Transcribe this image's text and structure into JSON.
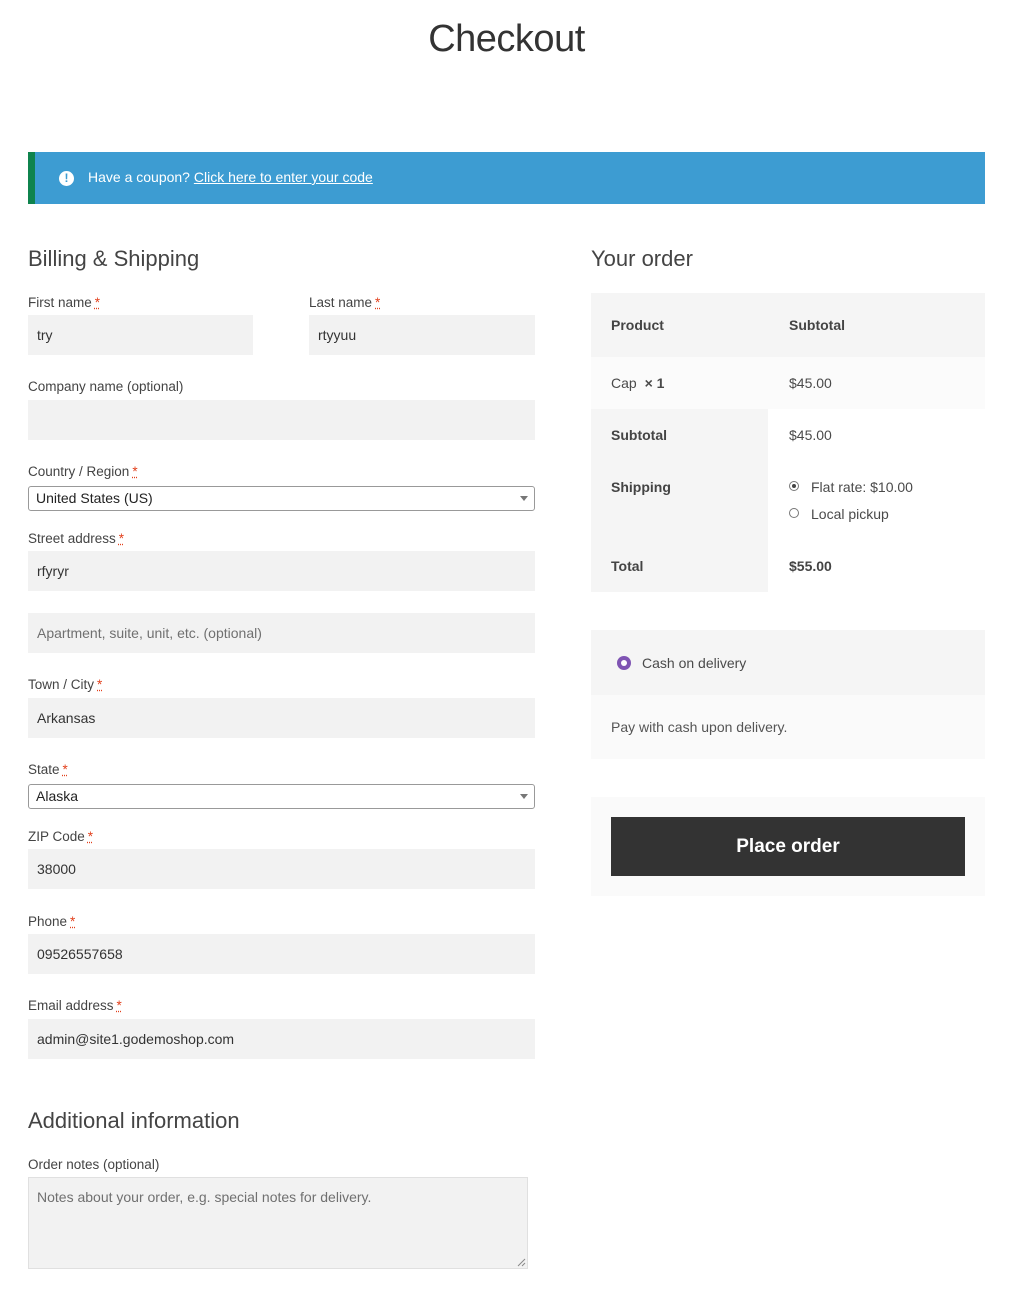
{
  "page": {
    "title": "Checkout"
  },
  "coupon": {
    "prompt": "Have a coupon?",
    "link": "Click here to enter your code"
  },
  "billing": {
    "heading": "Billing & Shipping",
    "required_mark": "*",
    "first_name": {
      "label": "First name",
      "value": "try"
    },
    "last_name": {
      "label": "Last name",
      "value": "rtyyuu"
    },
    "company": {
      "label": "Company name (optional)",
      "value": ""
    },
    "country": {
      "label": "Country / Region",
      "value": "United States (US)"
    },
    "street": {
      "label": "Street address",
      "value": "rfyryr",
      "placeholder2": "Apartment, suite, unit, etc. (optional)"
    },
    "city": {
      "label": "Town / City",
      "value": "Arkansas"
    },
    "state": {
      "label": "State",
      "value": "Alaska"
    },
    "zip": {
      "label": "ZIP Code",
      "value": "38000"
    },
    "phone": {
      "label": "Phone",
      "value": "09526557658"
    },
    "email": {
      "label": "Email address",
      "value": "admin@site1.godemoshop.com"
    }
  },
  "additional": {
    "heading": "Additional information",
    "notes_label": "Order notes (optional)",
    "notes_placeholder": "Notes about your order, e.g. special notes for delivery."
  },
  "order": {
    "heading": "Your order",
    "col_product": "Product",
    "col_subtotal": "Subtotal",
    "item_name": "Cap",
    "item_qty": "× 1",
    "item_price": "$45.00",
    "subtotal_label": "Subtotal",
    "subtotal_value": "$45.00",
    "shipping_label": "Shipping",
    "shipping_option_1": "Flat rate: $10.00",
    "shipping_option_2": "Local pickup",
    "total_label": "Total",
    "total_value": "$55.00"
  },
  "payment": {
    "method": "Cash on delivery",
    "description": "Pay with cash upon delivery.",
    "accent": "#7f54b3"
  },
  "place_order": {
    "label": "Place order"
  },
  "colors": {
    "coupon_bg": "#3d9cd2",
    "coupon_border": "#0f834d",
    "button_bg": "#333333",
    "required": "#e2401c"
  }
}
